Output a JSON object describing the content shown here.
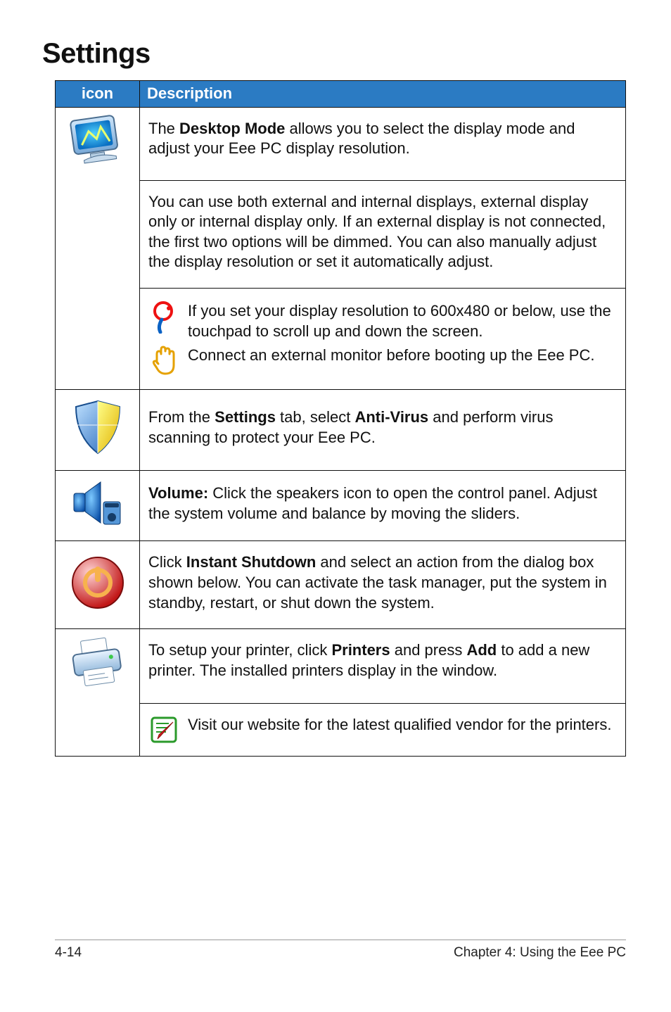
{
  "heading": "Settings",
  "table": {
    "headers": {
      "icon": "icon",
      "desc": "Description"
    }
  },
  "rows": {
    "desktop": {
      "p1a": "The ",
      "p1b": "Desktop Mode",
      "p1c": " allows you to select the display mode and adjust your Eee PC display resolution.",
      "p2": "You can use both external and internal displays, external display only or internal display only. If an external display is not connected, the first two options will be dimmed. You can also manually adjust the display resolution or set it automatically adjust.",
      "note1": "If you set your display resolution to 600x480 or below, use the touchpad to scroll up and down the screen.",
      "note2": "Connect an external monitor before booting up the Eee PC."
    },
    "antivirus": {
      "t1": "From the ",
      "t2": "Settings",
      "t3": " tab, select ",
      "t4": "Anti-Virus",
      "t5": " and perform virus scanning to protect your Eee PC."
    },
    "volume": {
      "label": "Volume:",
      "text": " Click the speakers icon to open the control panel. Adjust the system volume and balance by moving the sliders."
    },
    "shutdown": {
      "t1": "Click ",
      "t2": "Instant Shutdown",
      "t3": " and select an action from the dialog box shown below. You can activate the task manager, put the system in standby, restart, or shut down the system."
    },
    "printers": {
      "t1": "To setup your printer, click ",
      "t2": "Printers",
      "t3": " and press ",
      "t4": "Add",
      "t5": " to add a new printer. The installed printers display in the window.",
      "note": "Visit our website for the latest qualified vendor for the printers."
    }
  },
  "footer": {
    "left": "4-14",
    "right": "Chapter 4: Using the Eee PC"
  }
}
